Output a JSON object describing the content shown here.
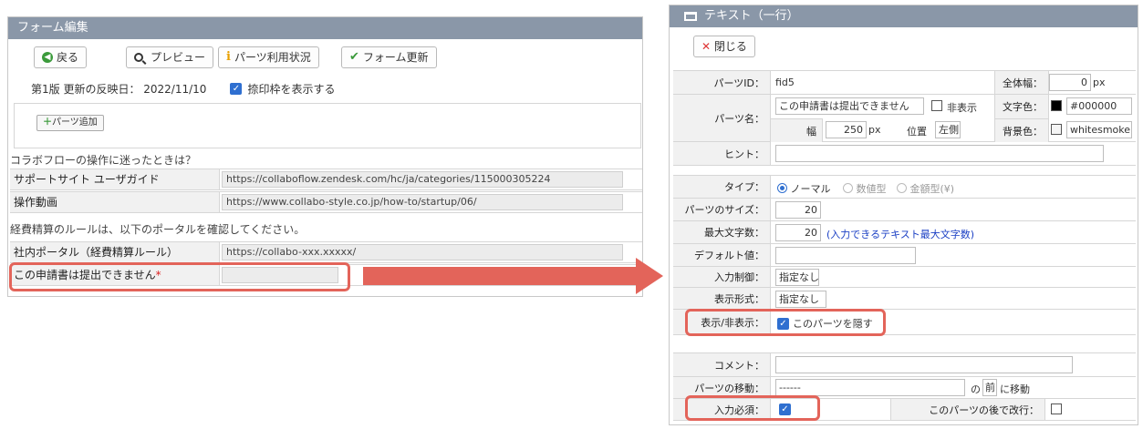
{
  "left": {
    "title": "フォーム編集",
    "buttons": {
      "back": "戻る",
      "preview": "プレビュー",
      "usage": "パーツ利用状況",
      "update": "フォーム更新"
    },
    "version_text": "第1版 更新の反映日： 2022/11/10",
    "show_print_frame": "捺印枠を表示する",
    "add_parts": "パーツ追加",
    "note1": "コラボフローの操作に迷ったときは？",
    "rows1": [
      {
        "label": "サポートサイト ユーザガイド",
        "value": "https://collaboflow.zendesk.com/hc/ja/categories/115000305224"
      },
      {
        "label": "操作動画",
        "value": "https://www.collabo-style.co.jp/how-to/startup/06/"
      }
    ],
    "note2": "経費精算のルールは、以下のポータルを確認してください。",
    "rows2": [
      {
        "label": "社内ポータル（経費精算ルール）",
        "value": "https://collabo-xxx.xxxxx/"
      },
      {
        "label": "この申請書は提出できません",
        "required_mark": "*",
        "value": ""
      }
    ]
  },
  "right": {
    "title": "テキスト（一行）",
    "close_label": "閉じる",
    "parts_id_label": "パーツID：",
    "parts_id_value": "fid5",
    "full_width_label": "全体幅：",
    "full_width_value": "0",
    "full_width_unit": "px",
    "parts_name_label": "パーツ名：",
    "parts_name_value": "この申請書は提出できません",
    "hidden_label": "非表示",
    "text_color_label": "文字色：",
    "text_color_value": "#000000",
    "width_label": "幅",
    "width_value": "250",
    "width_unit": "px",
    "position_label": "位置",
    "position_value": "左側",
    "bg_color_label": "背景色：",
    "bg_color_value": "whitesmoke",
    "hint_label": "ヒント：",
    "type_label": "タイプ：",
    "type_options": [
      "ノーマル",
      "数値型",
      "金額型(¥)"
    ],
    "size_label": "パーツのサイズ：",
    "size_value": "20",
    "maxlen_label": "最大文字数：",
    "maxlen_value": "20",
    "maxlen_note": "(入力できるテキスト最大文字数)",
    "default_label": "デフォルト値：",
    "input_ctrl_label": "入力制御：",
    "input_ctrl_value": "指定なし",
    "display_fmt_label": "表示形式：",
    "display_fmt_value": "指定なし",
    "visibility_label": "表示/非表示：",
    "hide_parts_label": "このパーツを隠す",
    "comment_label": "コメント：",
    "move_label": "パーツの移動：",
    "move_value": "------",
    "move_of": "の",
    "move_before": "前",
    "move_to": "に移動",
    "required_label": "入力必須：",
    "newline_label": "このパーツの後で改行：",
    "colors": {
      "accent": "#e3645a",
      "header": "#8a97a8",
      "check": "#2f6fd0"
    }
  }
}
